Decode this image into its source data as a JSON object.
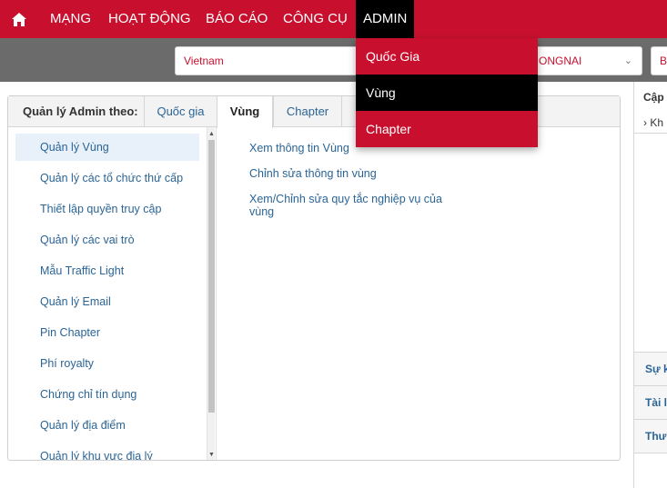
{
  "nav": {
    "items": [
      "MẠNG",
      "HOẠT ĐỘNG",
      "BÁO CÁO",
      "CÔNG CỤ",
      "ADMIN"
    ]
  },
  "filters": {
    "country": "Vietnam",
    "province": "ONGNAI",
    "extra": "B"
  },
  "admin_menu": {
    "items": [
      "Quốc Gia",
      "Vùng",
      "Chapter"
    ],
    "selected": "Vùng"
  },
  "panel": {
    "label": "Quản lý Admin theo:",
    "tabs": [
      "Quốc gia",
      "Vùng",
      "Chapter"
    ],
    "active_tab": "Vùng"
  },
  "left_menu": {
    "items": [
      "Quản lý Vùng",
      "Quản lý các tổ chức thứ cấp",
      "Thiết lập quyền truy cập",
      "Quản lý các vai trò",
      "Mẫu Traffic Light",
      "Quản lý Email",
      "Pin Chapter",
      "Phí royalty",
      "Chứng chỉ tín dụng",
      "Quản lý địa điểm",
      "Quản lý khu vực địa lý"
    ],
    "active": "Quản lý Vùng"
  },
  "content_links": [
    "Xem thông tin Vùng",
    "Chỉnh sửa thông tin vùng",
    "Xem/Chỉnh sửa quy tắc nghiệp vụ của vùng"
  ],
  "right_panel": {
    "title": "Cập",
    "sub": "› Kh",
    "sections": [
      "Sự k",
      "Tài l",
      "Thư"
    ]
  },
  "colors": {
    "brand_red": "#c8102e",
    "filter_gray": "#6b6b6b",
    "link_blue": "#2a6496"
  },
  "icons": {
    "home": "home-icon",
    "dropdown": "chevron-down-icon"
  }
}
